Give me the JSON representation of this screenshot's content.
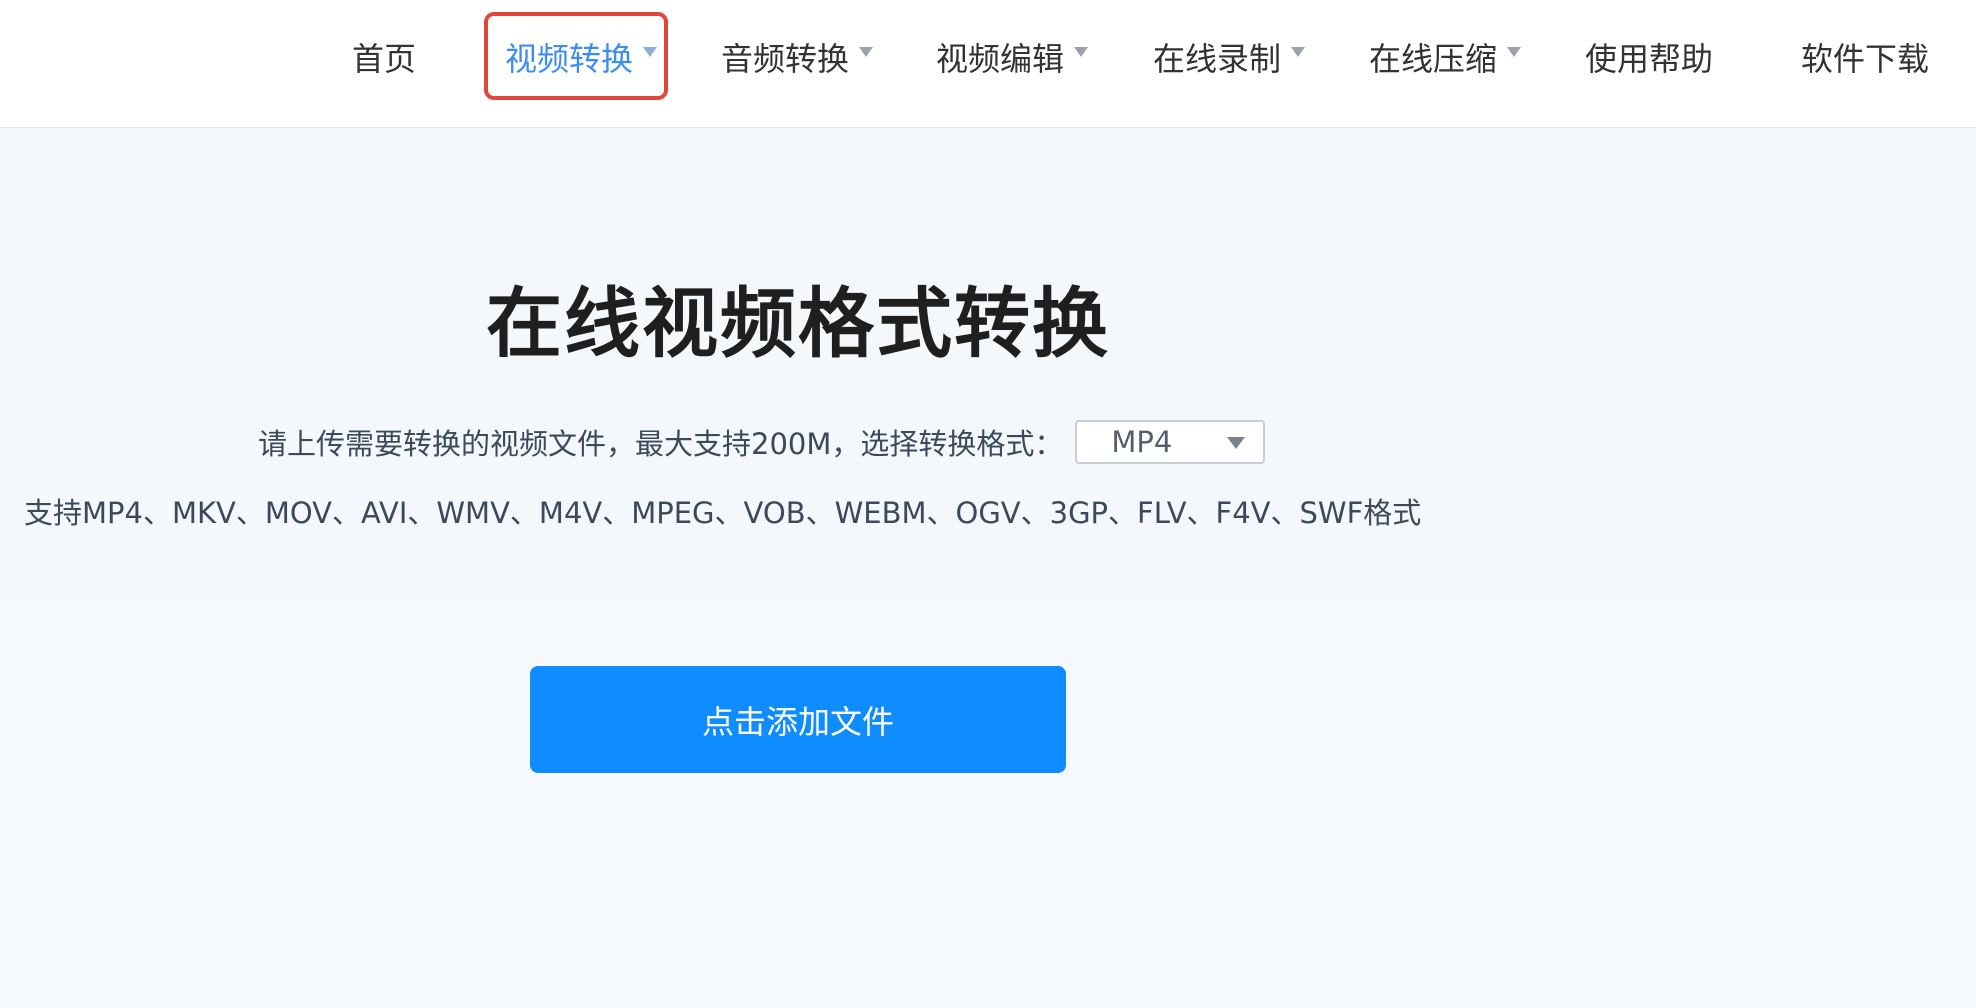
{
  "nav": {
    "items": [
      {
        "label": "首页",
        "has_dropdown": false,
        "active": false
      },
      {
        "label": "视频转换",
        "has_dropdown": true,
        "active": true
      },
      {
        "label": "音频转换",
        "has_dropdown": true,
        "active": false
      },
      {
        "label": "视频编辑",
        "has_dropdown": true,
        "active": false
      },
      {
        "label": "在线录制",
        "has_dropdown": true,
        "active": false
      },
      {
        "label": "在线压缩",
        "has_dropdown": true,
        "active": false
      },
      {
        "label": "使用帮助",
        "has_dropdown": false,
        "active": false
      },
      {
        "label": "软件下载",
        "has_dropdown": false,
        "active": false
      }
    ]
  },
  "main": {
    "title": "在线视频格式转换",
    "upload_hint": "请上传需要转换的视频文件，最大支持200M，选择转换格式：",
    "format_select": {
      "selected": "MP4"
    },
    "supported_formats": "支持MP4、MKV、MOV、AVI、WMV、M4V、MPEG、VOB、WEBM、OGV、3GP、FLV、F4V、SWF格式",
    "add_file_button": "点击添加文件"
  },
  "colors": {
    "accent": "#0f8cff",
    "nav_active": "#3b8ef0",
    "highlight_border": "#e0473a"
  }
}
